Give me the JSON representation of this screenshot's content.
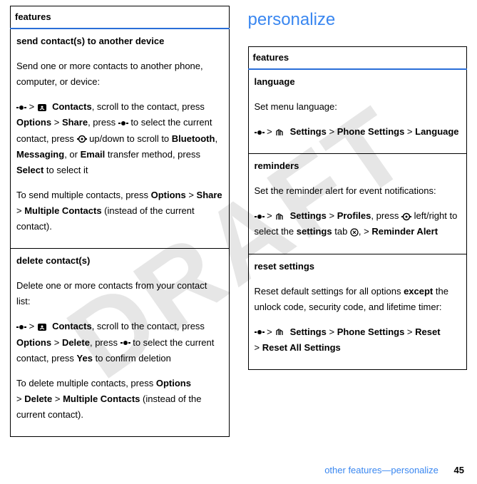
{
  "watermark": "DRAFT",
  "left": {
    "header": "features",
    "rows": [
      {
        "title": "send contact(s) to another device",
        "intro": "Send one or more contacts to another phone, computer, or device:",
        "path_contacts": "Contacts",
        "path_scroll1": ", scroll to the contact, press ",
        "path_options": "Options",
        "path_share": "Share",
        "path_press": ", press ",
        "path_select_current": " to select the current contact, press ",
        "path_updown": " up/down to scroll to ",
        "path_bluetooth": "Bluetooth",
        "path_messaging": "Messaging",
        "path_or": ", or ",
        "path_email": "Email",
        "path_transfer": " transfer method, press ",
        "path_select": "Select",
        "path_selectit": " to select it",
        "multi_prefix": "To send multiple contacts, press ",
        "multi_options": "Options",
        "multi_share": "Share",
        "multi_mc": "Multiple Contacts",
        "multi_suffix": " (instead of the current contact)."
      },
      {
        "title": "delete contact(s)",
        "intro": "Delete one or more contacts from your contact list:",
        "path_contacts": "Contacts",
        "path_scroll1": ", scroll to the contact, press ",
        "path_options": "Options",
        "path_delete": "Delete",
        "path_press": ", press ",
        "path_select_current": " to select the current contact, press ",
        "path_yes": "Yes",
        "path_confirm": " to confirm deletion",
        "multi_prefix": "To delete multiple contacts, press ",
        "multi_options": "Options",
        "multi_delete": "Delete",
        "multi_mc": "Multiple Contacts",
        "multi_suffix": " (instead of the current contact)."
      }
    ]
  },
  "right": {
    "section_title": "personalize",
    "header": "features",
    "rows": [
      {
        "title": "language",
        "intro": "Set menu language:",
        "p_settings": "Settings",
        "p_phone": "Phone Settings",
        "p_lang": "Language"
      },
      {
        "title": "reminders",
        "intro": "Set the reminder alert for event notifications:",
        "p_settings": "Settings",
        "p_profiles": "Profiles",
        "p_press": ", press ",
        "p_lr": " left/right to select the ",
        "p_settings_word": "settings",
        "p_tab": " tab ",
        "p_reminder": "Reminder Alert"
      },
      {
        "title": "reset settings",
        "intro_a": "Reset default settings for all options ",
        "intro_except": "except",
        "intro_b": " the unlock code, security code, and lifetime timer:",
        "p_settings": "Settings",
        "p_phone": "Phone Settings",
        "p_reset": "Reset",
        "p_resetall": "Reset All Settings"
      }
    ]
  },
  "footer": {
    "text": "other features—personalize",
    "page": "45"
  }
}
